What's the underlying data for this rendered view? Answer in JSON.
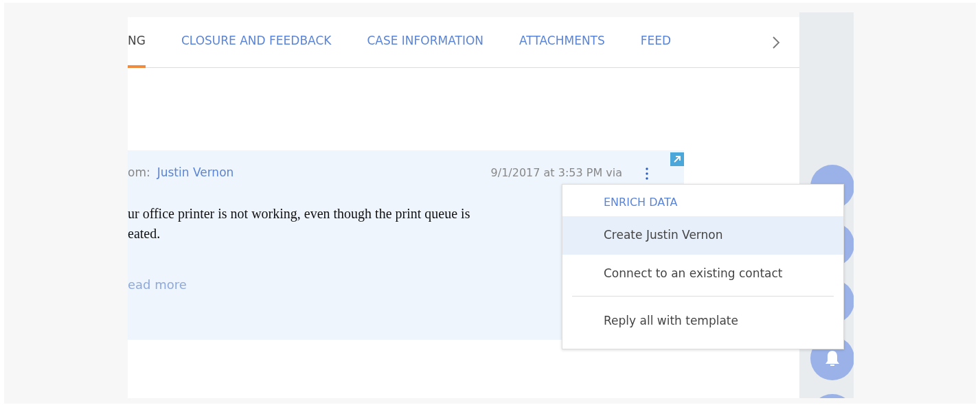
{
  "tabs": [
    {
      "label": "NG",
      "selected": true
    },
    {
      "label": "CLOSURE AND FEEDBACK",
      "selected": false
    },
    {
      "label": "CASE INFORMATION",
      "selected": false
    },
    {
      "label": "ATTACHMENTS",
      "selected": false
    },
    {
      "label": "FEED",
      "selected": false
    }
  ],
  "message": {
    "from_label": "om:",
    "sender": "Justin Vernon",
    "date": "9/1/2017 at 3:53 PM via",
    "body_lines": [
      "ur office printer is not working, even though the print queue is",
      "eated."
    ],
    "read_more": "ead more"
  },
  "menu": {
    "items": [
      {
        "kind": "heading",
        "label": "ENRICH DATA"
      },
      {
        "kind": "item",
        "label": "Create Justin Vernon",
        "selected": true
      },
      {
        "kind": "item",
        "label": "Connect to an existing contact",
        "selected": false
      },
      {
        "kind": "divider"
      },
      {
        "kind": "item",
        "label": "Reply all with template",
        "selected": false
      }
    ]
  }
}
